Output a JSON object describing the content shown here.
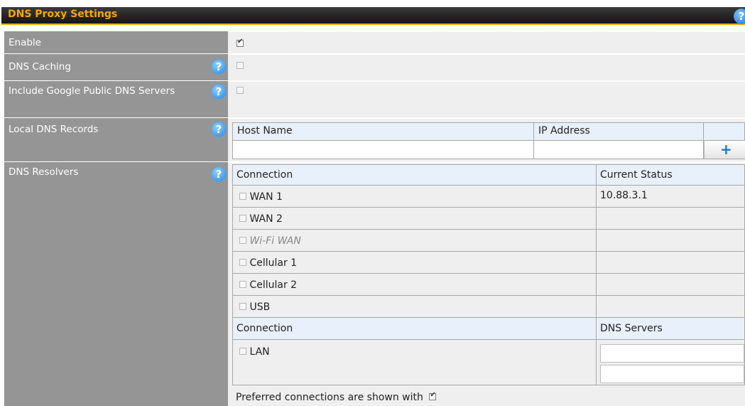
{
  "header": {
    "title": "DNS Proxy Settings",
    "help": "?"
  },
  "rows": {
    "enable": {
      "label": "Enable",
      "checked": true
    },
    "dns_caching": {
      "label": "DNS Caching",
      "checked": false,
      "help": "?"
    },
    "google_dns": {
      "label": "Include Google Public DNS Servers",
      "checked": false,
      "help": "?"
    },
    "local_records": {
      "label": "Local DNS Records",
      "help": "?",
      "columns": [
        "Host Name",
        "IP Address"
      ],
      "host_value": "",
      "ip_value": "",
      "add_icon": "+"
    },
    "resolvers": {
      "label": "DNS Resolvers",
      "help": "?",
      "wan_header": {
        "connection": "Connection",
        "status": "Current Status"
      },
      "wan_rows": [
        {
          "name": "WAN 1",
          "status": "10.88.3.1",
          "checked": false,
          "disabled": false
        },
        {
          "name": "WAN 2",
          "status": "",
          "checked": false,
          "disabled": false
        },
        {
          "name": "Wi-Fi WAN",
          "status": "",
          "checked": false,
          "disabled": true
        },
        {
          "name": "Cellular 1",
          "status": "",
          "checked": false,
          "disabled": false
        },
        {
          "name": "Cellular 2",
          "status": "",
          "checked": false,
          "disabled": false
        },
        {
          "name": "USB",
          "status": "",
          "checked": false,
          "disabled": false
        }
      ],
      "lan_header": {
        "connection": "Connection",
        "servers": "DNS Servers"
      },
      "lan_row": {
        "name": "LAN",
        "checked": false,
        "server1": "",
        "server2": ""
      },
      "note": "Preferred connections are shown with"
    }
  }
}
